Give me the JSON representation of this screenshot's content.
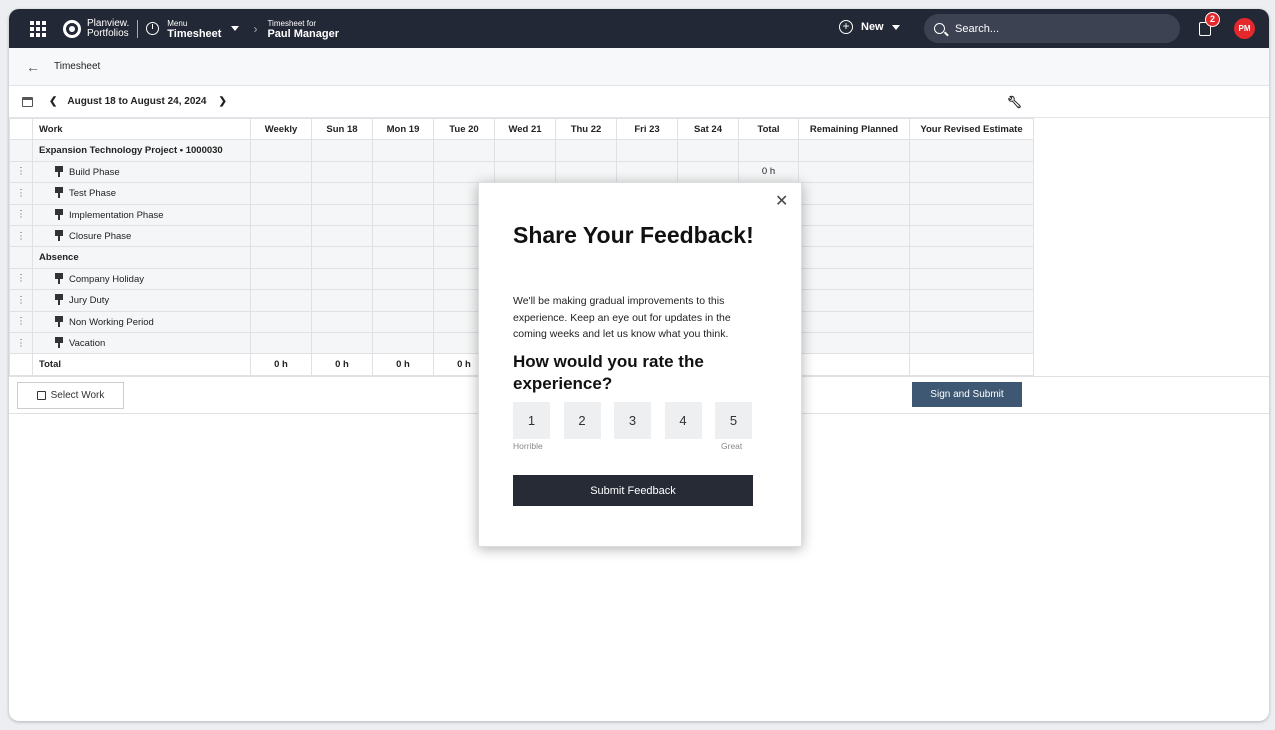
{
  "topbar": {
    "logo_line1": "Planview.",
    "logo_line2": "Portfolios",
    "menu_small": "Menu",
    "menu_big": "Timesheet",
    "crumb_small": "Timesheet for",
    "crumb_big": "Paul Manager",
    "new_label": "New",
    "search_placeholder": "Search...",
    "notif_count": "2",
    "avatar_initials": "PM",
    "bg_color": "#232836",
    "avatar_color": "#e4282b"
  },
  "subhead": {
    "title": "Timesheet"
  },
  "period": {
    "label": "August 18 to August 24, 2024"
  },
  "table": {
    "columns": [
      "Work",
      "Weekly",
      "Sun 18",
      "Mon 19",
      "Tue 20",
      "Wed 21",
      "Thu 22",
      "Fri 23",
      "Sat 24",
      "Total",
      "Remaining Planned",
      "Your Revised Estimate"
    ],
    "project_group": "Expansion Technology Project • 1000030",
    "project_rows": [
      "Build Phase",
      "Test Phase",
      "Implementation Phase",
      "Closure Phase"
    ],
    "build_total": "0 h",
    "absence_group": "Absence",
    "absence_rows": [
      "Company Holiday",
      "Jury Duty",
      "Non Working Period",
      "Vacation"
    ],
    "total_label": "Total",
    "totals": [
      "0 h",
      "0 h",
      "0 h",
      "0 h"
    ]
  },
  "actions": {
    "select_work": "Select Work",
    "sign_submit": "Sign and Submit",
    "sign_color": "#3e5873"
  },
  "modal": {
    "title": "Share Your Feedback!",
    "body": "We'll be making gradual improvements to this experience. Keep an eye out for updates in the coming weeks and let us know what you think.",
    "question": "How would you rate the experience?",
    "ratings": [
      "1",
      "2",
      "3",
      "4",
      "5"
    ],
    "low_label": "Horrible",
    "high_label": "Great",
    "submit_label": "Submit Feedback"
  }
}
